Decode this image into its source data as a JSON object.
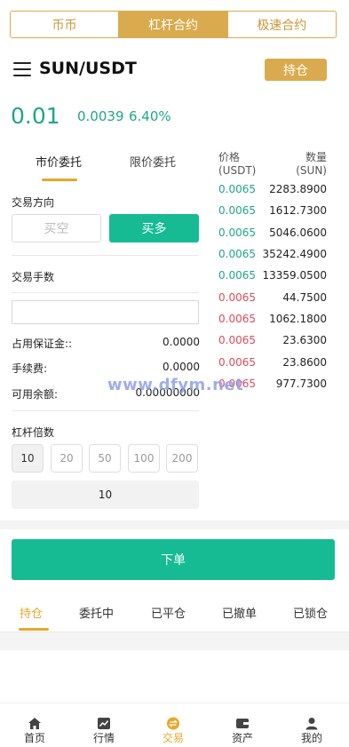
{
  "top_tabs": [
    {
      "label": "币币",
      "active": false
    },
    {
      "label": "杠杆合约",
      "active": true
    },
    {
      "label": "极速合约",
      "active": false
    }
  ],
  "header": {
    "menu_icon": "hamburger-menu-icon",
    "pair": "SUN/USDT",
    "hold_label": "持仓"
  },
  "ticker": {
    "price": "0.01",
    "change": "0.0039",
    "percent": "6.40%",
    "color": "#1fa58a"
  },
  "order_tabs": {
    "market": "市价委托",
    "limit": "限价委托",
    "active": "market"
  },
  "form": {
    "direction_label": "交易方向",
    "short_label": "买空",
    "long_label": "买多",
    "quantity_label": "交易手数",
    "quantity_value": "",
    "margin_label": "占用保证金::",
    "margin_value": "0.0000",
    "fee_label": "手续费:",
    "fee_value": "0.0000",
    "available_label": "可用余额:",
    "available_value": "0.00000000",
    "leverage_label": "杠杆倍数",
    "leverage_options": [
      "10",
      "20",
      "50",
      "100",
      "200"
    ],
    "leverage_selected": "10",
    "leverage_display": "10"
  },
  "order_book": {
    "price_header_1": "价格",
    "price_header_2": "(USDT)",
    "qty_header_1": "数量",
    "qty_header_2": "(SUN)",
    "rows": [
      {
        "price": "0.0065",
        "qty": "2283.8900",
        "side": "buy"
      },
      {
        "price": "0.0065",
        "qty": "1612.7300",
        "side": "buy"
      },
      {
        "price": "0.0065",
        "qty": "5046.0600",
        "side": "buy"
      },
      {
        "price": "0.0065",
        "qty": "35242.4900",
        "side": "buy"
      },
      {
        "price": "0.0065",
        "qty": "13359.0500",
        "side": "buy"
      },
      {
        "price": "0.0065",
        "qty": "44.7500",
        "side": "sell"
      },
      {
        "price": "0.0065",
        "qty": "1062.1800",
        "side": "sell"
      },
      {
        "price": "0.0065",
        "qty": "23.6300",
        "side": "sell"
      },
      {
        "price": "0.0065",
        "qty": "23.8600",
        "side": "sell"
      },
      {
        "price": "0.0065",
        "qty": "977.7300",
        "side": "sell"
      }
    ]
  },
  "watermark": "www.dfym.net",
  "place_order_label": "下单",
  "position_tabs": [
    {
      "label": "持仓",
      "active": true
    },
    {
      "label": "委托中",
      "active": false
    },
    {
      "label": "已平仓",
      "active": false
    },
    {
      "label": "已撤单",
      "active": false
    },
    {
      "label": "已锁仓",
      "active": false
    }
  ],
  "bottom_nav": [
    {
      "label": "首页",
      "icon": "home-icon",
      "active": false
    },
    {
      "label": "行情",
      "icon": "chart-icon",
      "active": false
    },
    {
      "label": "交易",
      "icon": "trade-icon",
      "active": true
    },
    {
      "label": "资产",
      "icon": "wallet-icon",
      "active": false
    },
    {
      "label": "我的",
      "icon": "user-icon",
      "active": false
    }
  ],
  "colors": {
    "accent": "#d9ab4e",
    "buy": "#16bb93",
    "sell": "#dc4a5a",
    "tab_active": "#e6a82a"
  }
}
